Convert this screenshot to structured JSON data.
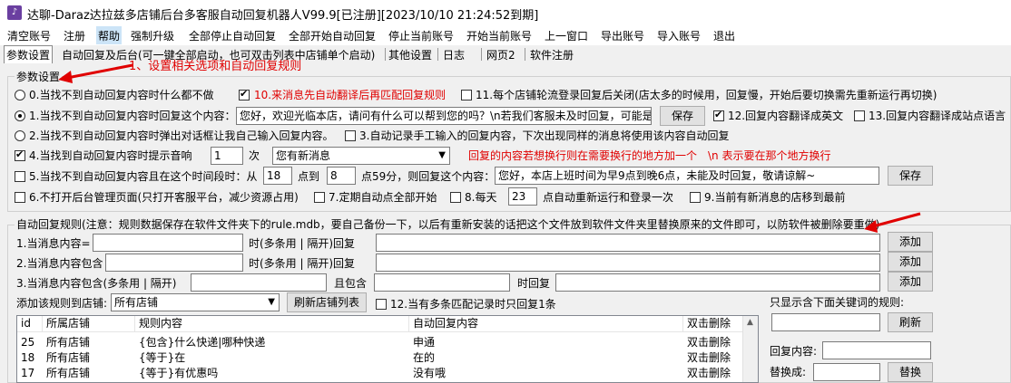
{
  "window": {
    "title": "达聊-Daraz达拉兹多店铺后台多客服自动回复机器人V99.9[已注册][2023/10/10 21:24:52到期]",
    "icon": "app-icon"
  },
  "menu": [
    "清空账号",
    "注册",
    "帮助",
    "强制升级",
    "全部停止自动回复",
    "全部开始自动回复",
    "停止当前账号",
    "开始当前账号",
    "上一窗口",
    "导出账号",
    "导入账号",
    "退出"
  ],
  "tabs": [
    "参数设置",
    "自动回复及后台(可一键全部启动，也可双击列表中店铺单个启动)",
    "其他设置",
    "日志",
    "网页2",
    "软件注册"
  ],
  "annotation": "1、设置相关选项和自动回复规则",
  "params": {
    "group_title": "参数设置",
    "opt0": "0.当找不到自动回复内容时什么都不做",
    "opt10": "10.来消息先自动翻译后再匹配回复规则",
    "opt11": "11.每个店铺轮流登录回复后关闭(店太多的时候用，回复慢，开始后要切换需先重新运行再切换)",
    "opt1": "1.当找不到自动回复内容时回复这个内容：",
    "opt1_value": "您好，欢迎光临本店，请问有什么可以帮到您的吗？\\n若我们客服未及时回复，可能是",
    "save": "保存",
    "opt12": "12.回复内容翻译成英文",
    "opt13": "13.回复内容翻译成站点语言",
    "opt2": "2.当找不到自动回复内容时弹出对话框让我自己输入回复内容。",
    "opt3": "3.自动记录手工输入的回复内容，下次出现同样的消息将使用该内容自动回复",
    "opt4": "4.当找到自动回复内容时提示音响",
    "opt4_count": "1",
    "opt4_unit": "次",
    "opt4_select": "您有新消息",
    "opt4_hint": "回复的内容若想换行则在需要换行的地方加一个　\\n 表示要在那个地方换行",
    "opt5": "5.当找不到自动回复内容且在这个时间段时：从",
    "opt5_from": "18",
    "opt5_mid": "点到",
    "opt5_to": "8",
    "opt5_tail": "点59分，则回复这个内容：",
    "opt5_value": "您好，本店上班时间为早9点到晚6点，未能及时回复，敬请谅解~",
    "opt6": "6.不打开后台管理页面(只打开客服平台，减少资源占用)",
    "opt7": "7.定期自动点全部开始",
    "opt8": "8.每天",
    "opt8_value": "23",
    "opt8_tail": "点自动重新运行和登录一次",
    "opt9": "9.当前有新消息的店移到最前"
  },
  "rules": {
    "group_title": "自动回复规则(注意：规则数据保存在软件文件夹下的rule.mdb，要自己备份一下，以后有重新安装的话把这个文件放到软件文件夹里替换原来的文件即可，以防软件被删除要重做)",
    "r1": "1.当消息内容=",
    "r1_mid": "时(多条用 | 隔开)回复",
    "r2": "2.当消息内容包含",
    "r2_mid": "时(多条用 | 隔开)回复",
    "r3": "3.当消息内容包含(多条用 | 隔开)",
    "r3_mid": "且包含",
    "r3_tail": "时回复",
    "add": "添加",
    "add_to_shop": "添加该规则到店铺:",
    "shop_select": "所有店铺",
    "refresh_shops": "刷新店铺列表",
    "opt12b": "12.当有多条匹配记录时只回复1条",
    "filter_label": "只显示含下面关键词的规则:",
    "refresh": "刷新",
    "reply_content": "回复内容:",
    "replace_with": "替换成:",
    "replace": "替换"
  },
  "table": {
    "columns": [
      "id",
      "所属店铺",
      "规则内容",
      "自动回复内容",
      "双击删除"
    ],
    "rows": [
      [
        "25",
        "所有店铺",
        "{包含}什么快递|哪种快递",
        "申通",
        "双击删除"
      ],
      [
        "18",
        "所有店铺",
        "{等于}在",
        "在的",
        "双击删除"
      ],
      [
        "17",
        "所有店铺",
        "{等于}有优惠吗",
        "没有哦",
        "双击删除"
      ]
    ]
  },
  "colors": {
    "annotation": "#e00000",
    "accent_red": "#e00000"
  }
}
